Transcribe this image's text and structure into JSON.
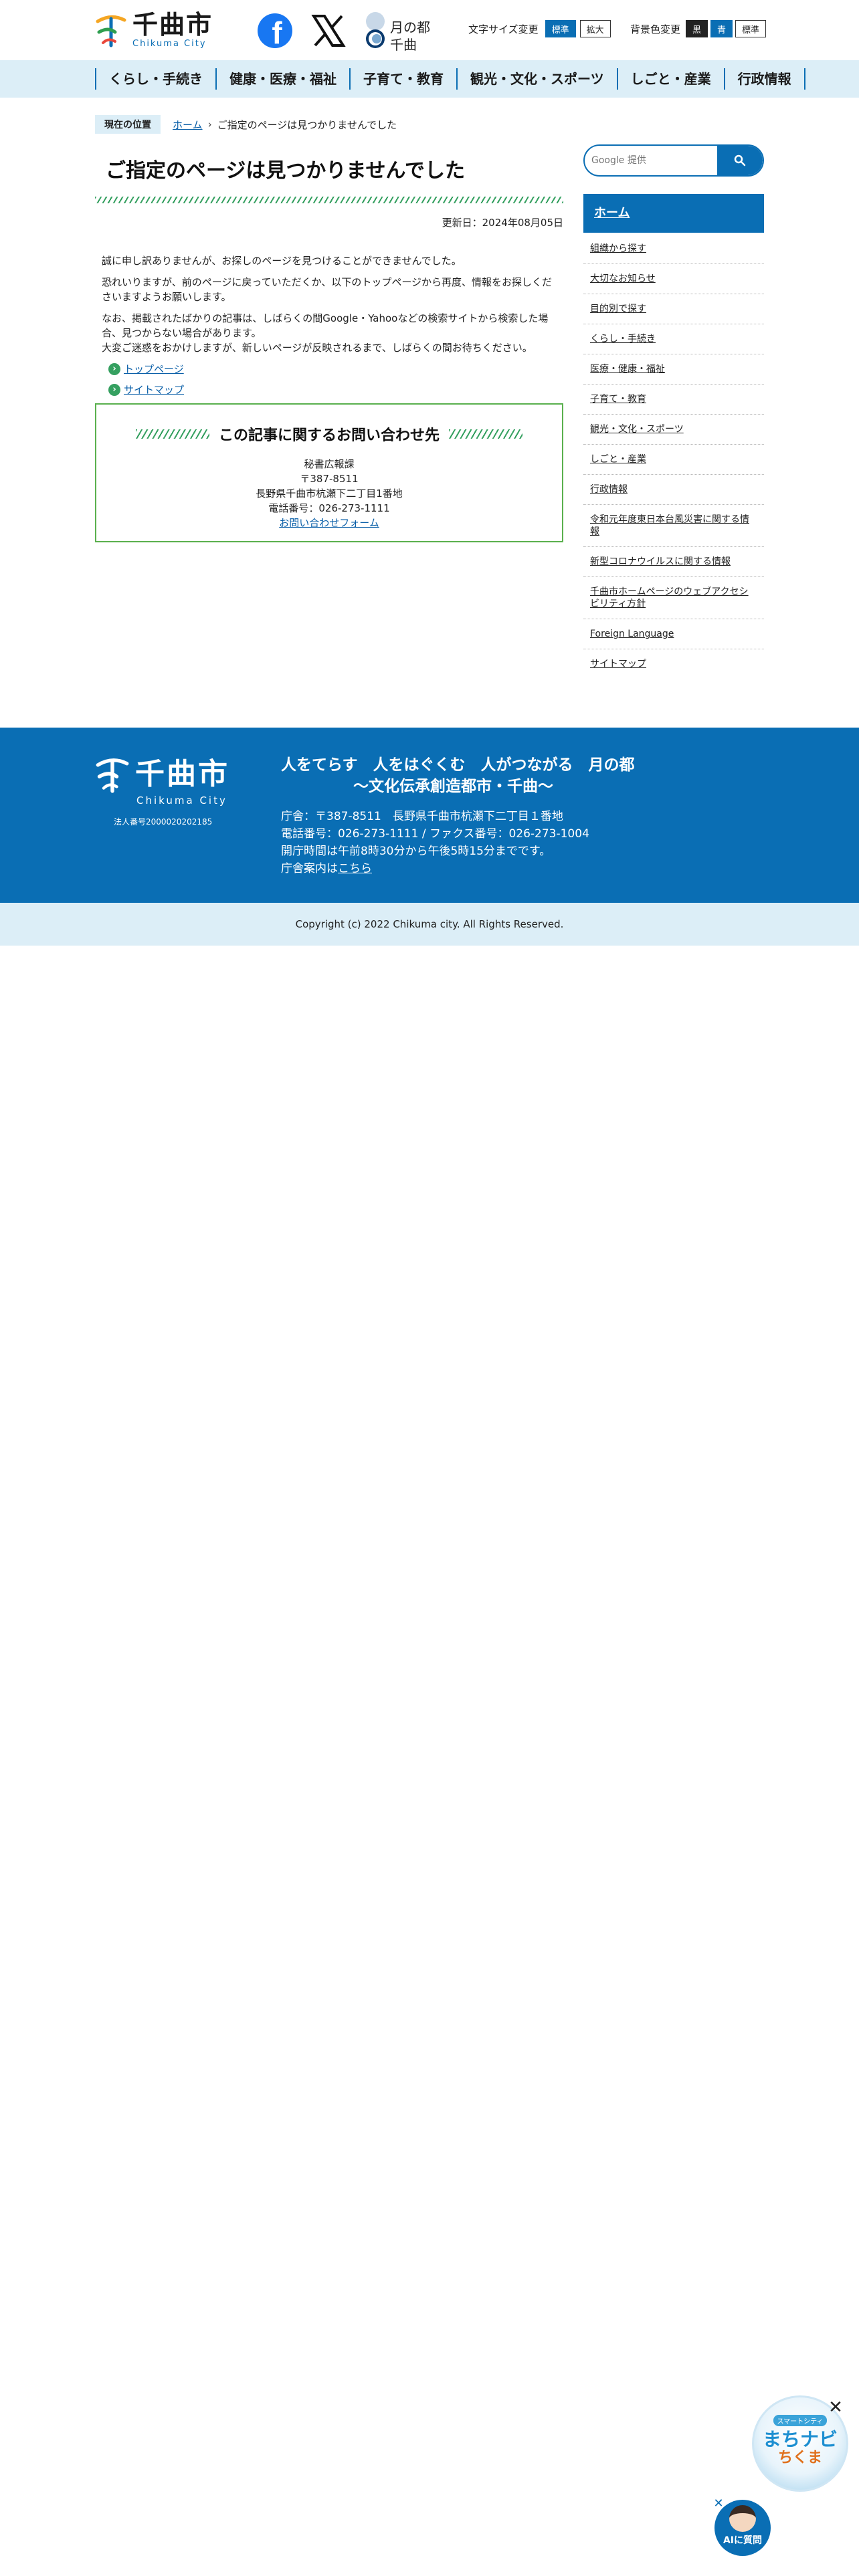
{
  "header": {
    "logo_jp": "千曲市",
    "logo_en": "Chikuma City",
    "tsuki_label": "月の都\n千曲",
    "font_size_label": "文字サイズ変更",
    "font_size_buttons": [
      "標準",
      "拡大"
    ],
    "bg_color_label": "背景色変更",
    "bg_color_buttons": [
      "黒",
      "青",
      "標準"
    ]
  },
  "gnav": [
    "くらし・手続き",
    "健康・医療・福祉",
    "子育て・教育",
    "観光・文化・スポーツ",
    "しごと・産業",
    "行政情報"
  ],
  "breadcrumb": {
    "label": "現在の位置",
    "home": "ホーム",
    "separator": "›",
    "current": "ご指定のページは見つかりませんでした"
  },
  "main": {
    "title": "ご指定のページは見つかりませんでした",
    "updated": "更新日：2024年08月05日",
    "paragraphs": [
      "誠に申し訳ありませんが、お探しのページを見つけることができませんでした。",
      "恐れいりますが、前のページに戻っていただくか、以下のトップページから再度、情報をお探しくださいますようお願いします。",
      "なお、掲載されたばかりの記事は、しばらくの間Google・Yahooなどの検索サイトから検索した場合、見つからない場合があります。",
      "大変ご迷惑をおかけしますが、新しいページが反映されるまで、しばらくの間お待ちください。"
    ],
    "links": [
      "トップページ",
      "サイトマップ"
    ]
  },
  "inquiry": {
    "title": "この記事に関するお問い合わせ先",
    "dept": "秘書広報課",
    "postal": "〒387-8511",
    "address": "長野県千曲市杭瀬下二丁目1番地",
    "phone": "電話番号：026-273-1111",
    "form_link": "お問い合わせフォーム"
  },
  "sidebar": {
    "search_placeholder": "Google 提供",
    "home": "ホーム",
    "items": [
      "組織から探す",
      "大切なお知らせ",
      "目的別で探す",
      "くらし・手続き",
      "医療・健康・福祉",
      "子育て・教育",
      "観光・文化・スポーツ",
      "しごと・産業",
      "行政情報",
      "令和元年度東日本台風災害に関する情報",
      "新型コロナウイルスに関する情報",
      "千曲市ホームページのウェブアクセシビリティ方針",
      "Foreign Language",
      "サイトマップ"
    ]
  },
  "footer": {
    "logo_jp": "千曲市",
    "logo_en": "Chikuma City",
    "corp_number": "法人番号2000020202185",
    "slogan_line1": "人をてらす　人をはぐくむ　人がつながる　月の都",
    "slogan_line2": "〜文化伝承創造都市・千曲〜",
    "office": "庁舎：〒387-8511　長野県千曲市杭瀬下二丁目１番地",
    "phone_fax": "電話番号：026-273-1111 / ファクス番号：026-273-1004",
    "hours": "開庁時間は午前8時30分から午後5時15分までです。",
    "guide_prefix": "庁舎案内は",
    "guide_link": "こちら",
    "copyright": "Copyright (c) 2022 Chikuma city. All Rights Reserved."
  },
  "widgets": {
    "machinavi_tag": "スマートシティ",
    "machinavi_main": "まちナビ",
    "machinavi_sub": "ちくま",
    "close_symbol": "✕",
    "ai_label": "AIに質問"
  },
  "colors": {
    "brand_blue": "#0a6eb4",
    "nav_bg": "#dceef7",
    "accent_green": "#35a060"
  }
}
